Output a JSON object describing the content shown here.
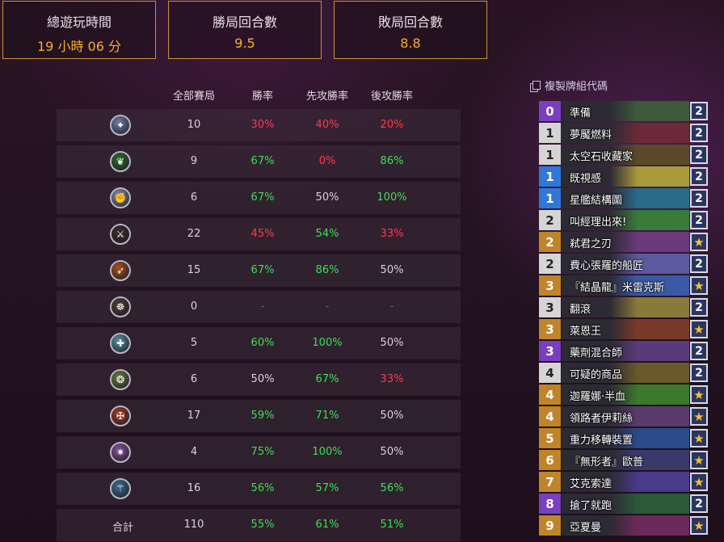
{
  "stats": [
    {
      "label": "總遊玩時間",
      "value": "19 小時 06 分"
    },
    {
      "label": "勝局回合數",
      "value": "9.5"
    },
    {
      "label": "敗局回合數",
      "value": "8.8"
    }
  ],
  "table": {
    "headers": [
      "全部賽局",
      "勝率",
      "先攻勝率",
      "後攻勝率"
    ],
    "rows": [
      {
        "icon": "mage-class-icon",
        "glyph": "✦",
        "games": "10",
        "wr": "30%",
        "wr_c": "red",
        "first": "40%",
        "first_c": "red",
        "second": "20%",
        "second_c": "red",
        "bg": "#6f7fa8"
      },
      {
        "icon": "druid-class-icon",
        "glyph": "❦",
        "games": "9",
        "wr": "67%",
        "wr_c": "green",
        "first": "0%",
        "first_c": "red",
        "second": "86%",
        "second_c": "green",
        "bg": "#2e6b2a"
      },
      {
        "icon": "paladin-class-icon",
        "glyph": "✊",
        "games": "6",
        "wr": "67%",
        "wr_c": "green",
        "first": "50%",
        "first_c": "white",
        "second": "100%",
        "second_c": "green",
        "bg": "#8a8fb5"
      },
      {
        "icon": "rogue-class-icon",
        "glyph": "⚔",
        "games": "22",
        "wr": "45%",
        "wr_c": "red",
        "first": "54%",
        "first_c": "green",
        "second": "33%",
        "second_c": "red",
        "bg": "#3a2f2c"
      },
      {
        "icon": "hunter-class-icon",
        "glyph": "➶",
        "games": "15",
        "wr": "67%",
        "wr_c": "green",
        "first": "86%",
        "first_c": "green",
        "second": "50%",
        "second_c": "white",
        "bg": "#a8521e"
      },
      {
        "icon": "unknown-class-icon",
        "glyph": "☸",
        "games": "0",
        "wr": "-",
        "wr_c": "dim",
        "first": "-",
        "first_c": "dim",
        "second": "-",
        "second_c": "dim",
        "bg": "#4d4030"
      },
      {
        "icon": "priest-class-icon",
        "glyph": "✚",
        "games": "5",
        "wr": "60%",
        "wr_c": "green",
        "first": "100%",
        "first_c": "green",
        "second": "50%",
        "second_c": "white",
        "bg": "#5b8fa8"
      },
      {
        "icon": "shaman-class-icon",
        "glyph": "❂",
        "games": "6",
        "wr": "50%",
        "wr_c": "white",
        "first": "67%",
        "first_c": "green",
        "second": "33%",
        "second_c": "red",
        "bg": "#6a7d38"
      },
      {
        "icon": "warrior-class-icon",
        "glyph": "✠",
        "games": "17",
        "wr": "59%",
        "wr_c": "green",
        "first": "71%",
        "first_c": "green",
        "second": "50%",
        "second_c": "white",
        "bg": "#a53a1c"
      },
      {
        "icon": "warlock-class-icon",
        "glyph": "✷",
        "games": "4",
        "wr": "75%",
        "wr_c": "green",
        "first": "100%",
        "first_c": "green",
        "second": "50%",
        "second_c": "white",
        "bg": "#8a4fa0"
      },
      {
        "icon": "demon-hunter-class-icon",
        "glyph": "⚚",
        "games": "16",
        "wr": "56%",
        "wr_c": "green",
        "first": "57%",
        "first_c": "green",
        "second": "56%",
        "second_c": "green",
        "bg": "#3f6f8a"
      }
    ],
    "total": {
      "label": "合計",
      "games": "110",
      "wr": "55%",
      "first": "61%",
      "second": "51%"
    }
  },
  "deck": {
    "copy_label": "複製牌組代碼",
    "cards": [
      {
        "cost": "0",
        "name": "準備",
        "count": "2",
        "rarity": "purple",
        "art": "#3e5a3a"
      },
      {
        "cost": "1",
        "name": "夢魘燃料",
        "count": "2",
        "rarity": "white",
        "art": "#6a2a3a"
      },
      {
        "cost": "1",
        "name": "太空石收藏家",
        "count": "2",
        "rarity": "white",
        "art": "#5a4a2a"
      },
      {
        "cost": "1",
        "name": "既視感",
        "count": "2",
        "rarity": "blue",
        "art": "#a89a3a"
      },
      {
        "cost": "1",
        "name": "星艦結構圖",
        "count": "2",
        "rarity": "blue",
        "art": "#2a6a8a"
      },
      {
        "cost": "2",
        "name": "叫經理出來!",
        "count": "2",
        "rarity": "white",
        "art": "#3a7a3a"
      },
      {
        "cost": "2",
        "name": "弒君之刃",
        "count": "★",
        "rarity": "gold",
        "art": "#6a3a7a"
      },
      {
        "cost": "2",
        "name": "費心張羅的船匠",
        "count": "2",
        "rarity": "white",
        "art": "#5a5aa0"
      },
      {
        "cost": "3",
        "name": "『結晶龍』米雷克斯",
        "count": "★",
        "rarity": "gold",
        "art": "#3a5aa8"
      },
      {
        "cost": "3",
        "name": "翻滾",
        "count": "2",
        "rarity": "white",
        "art": "#8a7a3a"
      },
      {
        "cost": "3",
        "name": "萊恩王",
        "count": "★",
        "rarity": "gold",
        "art": "#7a3a2a"
      },
      {
        "cost": "3",
        "name": "藥劑混合師",
        "count": "2",
        "rarity": "purple",
        "art": "#5a3a7a"
      },
      {
        "cost": "4",
        "name": "可疑的商品",
        "count": "2",
        "rarity": "white",
        "art": "#6a5a2a"
      },
      {
        "cost": "4",
        "name": "迦羅娜·半血",
        "count": "★",
        "rarity": "gold",
        "art": "#3a7a2a"
      },
      {
        "cost": "4",
        "name": "領路者伊莉絲",
        "count": "★",
        "rarity": "gold",
        "art": "#5a3a6a"
      },
      {
        "cost": "5",
        "name": "重力移轉裝置",
        "count": "★",
        "rarity": "gold",
        "art": "#2a4a8a"
      },
      {
        "cost": "6",
        "name": "『無形者』歐普",
        "count": "★",
        "rarity": "gold",
        "art": "#3a3a6a"
      },
      {
        "cost": "7",
        "name": "艾克索達",
        "count": "★",
        "rarity": "gold",
        "art": "#4a3a8a"
      },
      {
        "cost": "8",
        "name": "搶了就跑",
        "count": "2",
        "rarity": "purple",
        "art": "#2a5a3a"
      },
      {
        "cost": "9",
        "name": "亞夏曼",
        "count": "★",
        "rarity": "gold",
        "art": "#6a2a5a"
      }
    ]
  },
  "colors": {
    "accent": "#f5b02f",
    "green": "#3ce050",
    "red": "#ff3b4a",
    "white": "#d9d4d8",
    "dim": "#6f6570",
    "rarity": {
      "white": "#d5d5d5",
      "blue": "#2f78d8",
      "purple": "#7a3fbf",
      "gold": "#c0842a"
    }
  }
}
